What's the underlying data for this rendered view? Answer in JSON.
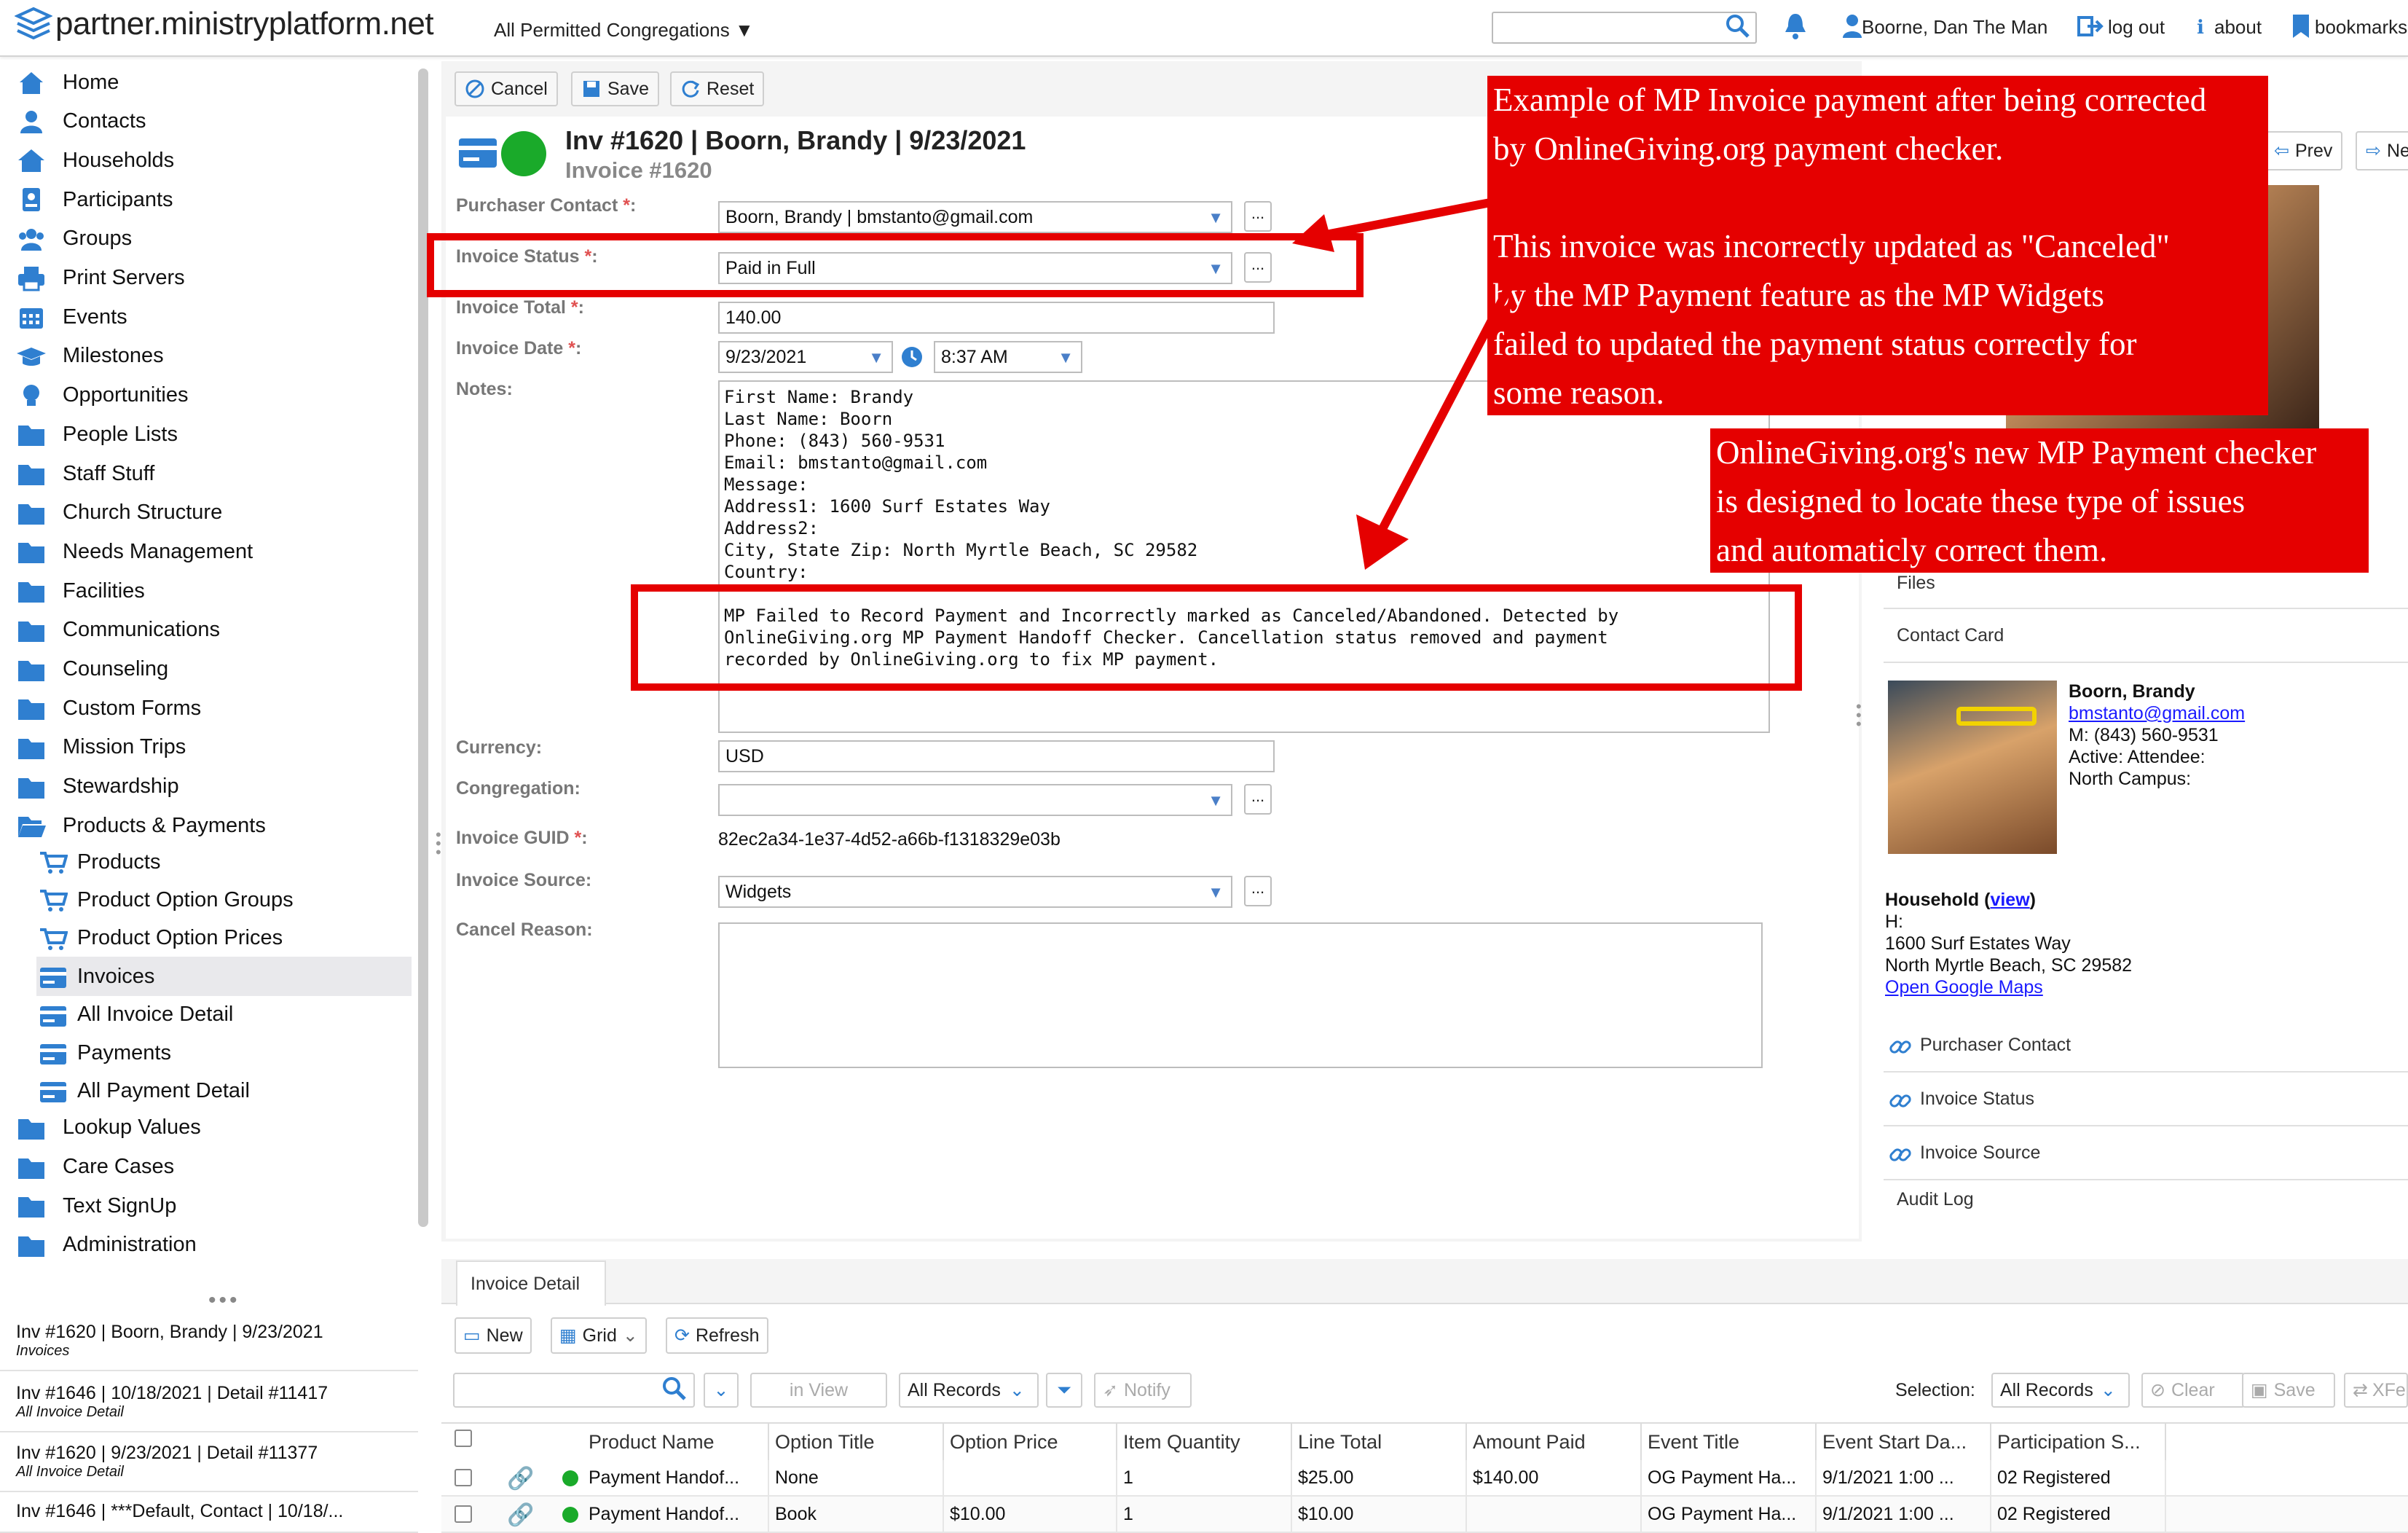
{
  "header": {
    "logo": "partner.ministryplatform.net",
    "congregation": "All Permitted Congregations",
    "user": "Boorne, Dan The Man",
    "logout": "log out",
    "about": "about",
    "bookmarks": "bookmarks"
  },
  "sidebar": {
    "items": [
      {
        "label": "Home",
        "icon": "home-icon"
      },
      {
        "label": "Contacts",
        "icon": "person-icon"
      },
      {
        "label": "Households",
        "icon": "house-icon"
      },
      {
        "label": "Participants",
        "icon": "id-badge-icon"
      },
      {
        "label": "Groups",
        "icon": "group-icon"
      },
      {
        "label": "Print Servers",
        "icon": "printer-icon"
      },
      {
        "label": "Events",
        "icon": "calendar-icon"
      },
      {
        "label": "Milestones",
        "icon": "graduation-cap-icon"
      },
      {
        "label": "Opportunities",
        "icon": "lightbulb-icon"
      },
      {
        "label": "People Lists",
        "icon": "folder-icon"
      },
      {
        "label": "Staff Stuff",
        "icon": "folder-icon"
      },
      {
        "label": "Church Structure",
        "icon": "folder-icon"
      },
      {
        "label": "Needs Management",
        "icon": "folder-icon"
      },
      {
        "label": "Facilities",
        "icon": "folder-icon"
      },
      {
        "label": "Communications",
        "icon": "folder-icon"
      },
      {
        "label": "Counseling",
        "icon": "folder-icon"
      },
      {
        "label": "Custom Forms",
        "icon": "folder-icon"
      },
      {
        "label": "Mission Trips",
        "icon": "folder-icon"
      },
      {
        "label": "Stewardship",
        "icon": "folder-icon"
      },
      {
        "label": "Products & Payments",
        "icon": "folder-open-icon"
      }
    ],
    "subitems": [
      {
        "label": "Products",
        "icon": "cart-icon"
      },
      {
        "label": "Product Option Groups",
        "icon": "cart-icon"
      },
      {
        "label": "Product Option Prices",
        "icon": "cart-icon"
      },
      {
        "label": "Invoices",
        "icon": "invoice-icon"
      },
      {
        "label": "All Invoice Detail",
        "icon": "invoice-icon"
      },
      {
        "label": "Payments",
        "icon": "invoice-icon"
      },
      {
        "label": "All Payment Detail",
        "icon": "invoice-icon"
      }
    ],
    "more": [
      {
        "label": "Lookup Values",
        "icon": "folder-icon"
      },
      {
        "label": "Care Cases",
        "icon": "folder-icon"
      },
      {
        "label": "Text SignUp",
        "icon": "folder-icon"
      },
      {
        "label": "Administration",
        "icon": "folder-icon"
      }
    ],
    "recent": [
      {
        "title": "Inv #1620 | Boorn, Brandy | 9/23/2021",
        "sub": "Invoices"
      },
      {
        "title": "Inv #1646 | 10/18/2021 | Detail #11417",
        "sub": "All Invoice Detail"
      },
      {
        "title": "Inv #1620 | 9/23/2021 | Detail #11377",
        "sub": "All Invoice Detail"
      },
      {
        "title": "Inv #1646 | ***Default, Contact | 10/18/...",
        "sub": ""
      }
    ]
  },
  "toolbar": {
    "cancel": "Cancel",
    "save": "Save",
    "reset": "Reset"
  },
  "record": {
    "title": "Inv #1620 | Boorn, Brandy | 9/23/2021",
    "subtitle": "Invoice #1620",
    "prev": "Prev",
    "next": "Ne"
  },
  "form": {
    "purchaser_label": "Purchaser Contact",
    "purchaser_value": "Boorn, Brandy | bmstanto@gmail.com",
    "status_label": "Invoice Status",
    "status_value": "Paid in Full",
    "total_label": "Invoice Total",
    "total_value": "140.00",
    "date_label": "Invoice Date",
    "date_value": "9/23/2021",
    "time_value": "8:37 AM",
    "notes_label": "Notes:",
    "notes_lines": [
      "First Name: Brandy",
      "Last Name: Boorn",
      "Phone: (843) 560-9531",
      "Email: bmstanto@gmail.com",
      "Message:",
      "Address1: 1600 Surf Estates Way",
      "Address2:",
      "City, State Zip: North Myrtle Beach, SC 29582",
      "Country:",
      "",
      "MP Failed to Record Payment and Incorrectly marked as Canceled/Abandoned. Detected by",
      "OnlineGiving.org MP Payment Handoff Checker. Cancellation status removed and payment",
      "recorded by OnlineGiving.org to fix MP payment."
    ],
    "currency_label": "Currency:",
    "currency_value": "USD",
    "congregation_label": "Congregation:",
    "congregation_value": "",
    "guid_label": "Invoice GUID",
    "guid_value": "82ec2a34-1e37-4d52-a66b-f1318329e03b",
    "source_label": "Invoice Source:",
    "source_value": "Widgets",
    "cancel_reason_label": "Cancel Reason:"
  },
  "callouts": {
    "top": [
      "Example of MP Invoice payment after being corrected",
      "by OnlineGiving.org payment checker.",
      "",
      "This invoice was incorrectly updated as \"Canceled\"",
      "by the MP Payment feature as the MP Widgets",
      "failed to updated the payment status correctly for",
      "some reason."
    ],
    "bottom": [
      "OnlineGiving.org's new MP Payment checker",
      "is designed to locate these type of issues",
      "and automaticly correct them."
    ]
  },
  "right_panel": {
    "files": "Files",
    "contact_card": "Contact Card",
    "name": "Boorn, Brandy",
    "email": "bmstanto@gmail.com",
    "mobile": "M: (843) 560-9531",
    "active": "Active: Attendee:",
    "campus": "North Campus:",
    "household_label": "Household (",
    "household_view": "view",
    "household_close": ")",
    "h": "H:",
    "addr1": "1600 Surf Estates Way",
    "addr2": "North Myrtle Beach, SC 29582",
    "maps": "Open Google Maps",
    "links": [
      "Purchaser Contact",
      "Invoice Status",
      "Invoice Source"
    ],
    "audit": "Audit Log"
  },
  "grid": {
    "tab": "Invoice Detail",
    "new": "New",
    "grid": "Grid",
    "refresh": "Refresh",
    "in_view": "in View",
    "records": "All Records",
    "notify": "Notify",
    "selection_label": "Selection:",
    "selection_value": "All Records",
    "clear": "Clear",
    "save": "Save",
    "xfer": "XFe",
    "columns": [
      "Product Name",
      "Option Title",
      "Option Price",
      "Item Quantity",
      "Line Total",
      "Amount Paid",
      "Event Title",
      "Event Start Da...",
      "Participation S..."
    ],
    "rows": [
      [
        "Payment Handof...",
        "None",
        "",
        "1",
        "$25.00",
        "$140.00",
        "OG Payment Ha...",
        "9/1/2021 1:00 ...",
        "02 Registered"
      ],
      [
        "Payment Handof...",
        "Book",
        "$10.00",
        "1",
        "$10.00",
        "",
        "OG Payment Ha...",
        "9/1/2021 1:00 ...",
        "02 Registered"
      ]
    ]
  },
  "colors": {
    "accent": "#2f7fd0",
    "red": "#e50000",
    "green": "#1aaa2a"
  }
}
